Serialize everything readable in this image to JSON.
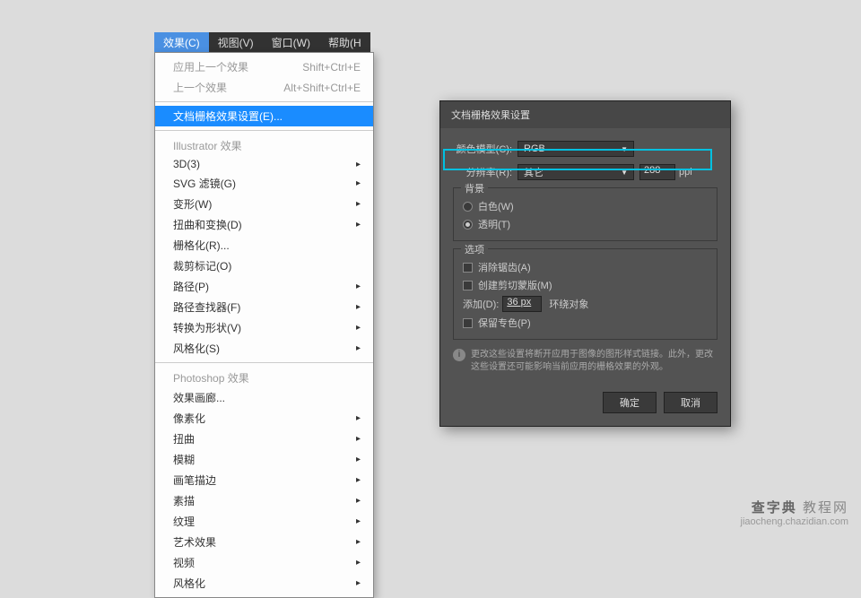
{
  "menubar": {
    "items": [
      {
        "label": "效果(C)",
        "active": true
      },
      {
        "label": "视图(V)"
      },
      {
        "label": "窗口(W)"
      },
      {
        "label": "帮助(H"
      }
    ]
  },
  "menu": {
    "top": [
      {
        "label": "应用上一个效果",
        "shortcut": "Shift+Ctrl+E",
        "disabled": true
      },
      {
        "label": "上一个效果",
        "shortcut": "Alt+Shift+Ctrl+E",
        "disabled": true
      }
    ],
    "highlighted": {
      "label": "文档栅格效果设置(E)..."
    },
    "section1_header": "Illustrator 效果",
    "section1": [
      {
        "label": "3D(3)",
        "sub": true
      },
      {
        "label": "SVG 滤镜(G)",
        "sub": true
      },
      {
        "label": "变形(W)",
        "sub": true
      },
      {
        "label": "扭曲和变换(D)",
        "sub": true
      },
      {
        "label": "栅格化(R)..."
      },
      {
        "label": "裁剪标记(O)"
      },
      {
        "label": "路径(P)",
        "sub": true
      },
      {
        "label": "路径查找器(F)",
        "sub": true
      },
      {
        "label": "转换为形状(V)",
        "sub": true
      },
      {
        "label": "风格化(S)",
        "sub": true
      }
    ],
    "section2_header": "Photoshop 效果",
    "section2": [
      {
        "label": "效果画廊..."
      },
      {
        "label": "像素化",
        "sub": true
      },
      {
        "label": "扭曲",
        "sub": true
      },
      {
        "label": "模糊",
        "sub": true
      },
      {
        "label": "画笔描边",
        "sub": true
      },
      {
        "label": "素描",
        "sub": true
      },
      {
        "label": "纹理",
        "sub": true
      },
      {
        "label": "艺术效果",
        "sub": true
      },
      {
        "label": "视频",
        "sub": true
      },
      {
        "label": "风格化",
        "sub": true
      }
    ]
  },
  "dialog": {
    "title": "文档栅格效果设置",
    "color_model_label": "颜色模型(C):",
    "color_model_value": "RGB",
    "resolution_label": "分辨率(R):",
    "resolution_value": "其它",
    "resolution_input": "288",
    "resolution_unit": "ppi",
    "bg": {
      "title": "背景",
      "white": "白色(W)",
      "transparent": "透明(T)"
    },
    "options": {
      "title": "选项",
      "antialias": "消除锯齿(A)",
      "clipmask": "创建剪切蒙版(M)",
      "add_label": "添加(D):",
      "add_value": "36 px",
      "add_suffix": "环绕对象",
      "preserve_spot": "保留专色(P)"
    },
    "info_text": "更改这些设置将断开应用于图像的图形样式链接。此外，更改这些设置还可能影响当前应用的栅格效果的外观。",
    "ok": "确定",
    "cancel": "取消"
  },
  "watermark": {
    "line1a": "查字典",
    "line1b": "教程网",
    "line2": "jiaocheng.chazidian.com"
  }
}
